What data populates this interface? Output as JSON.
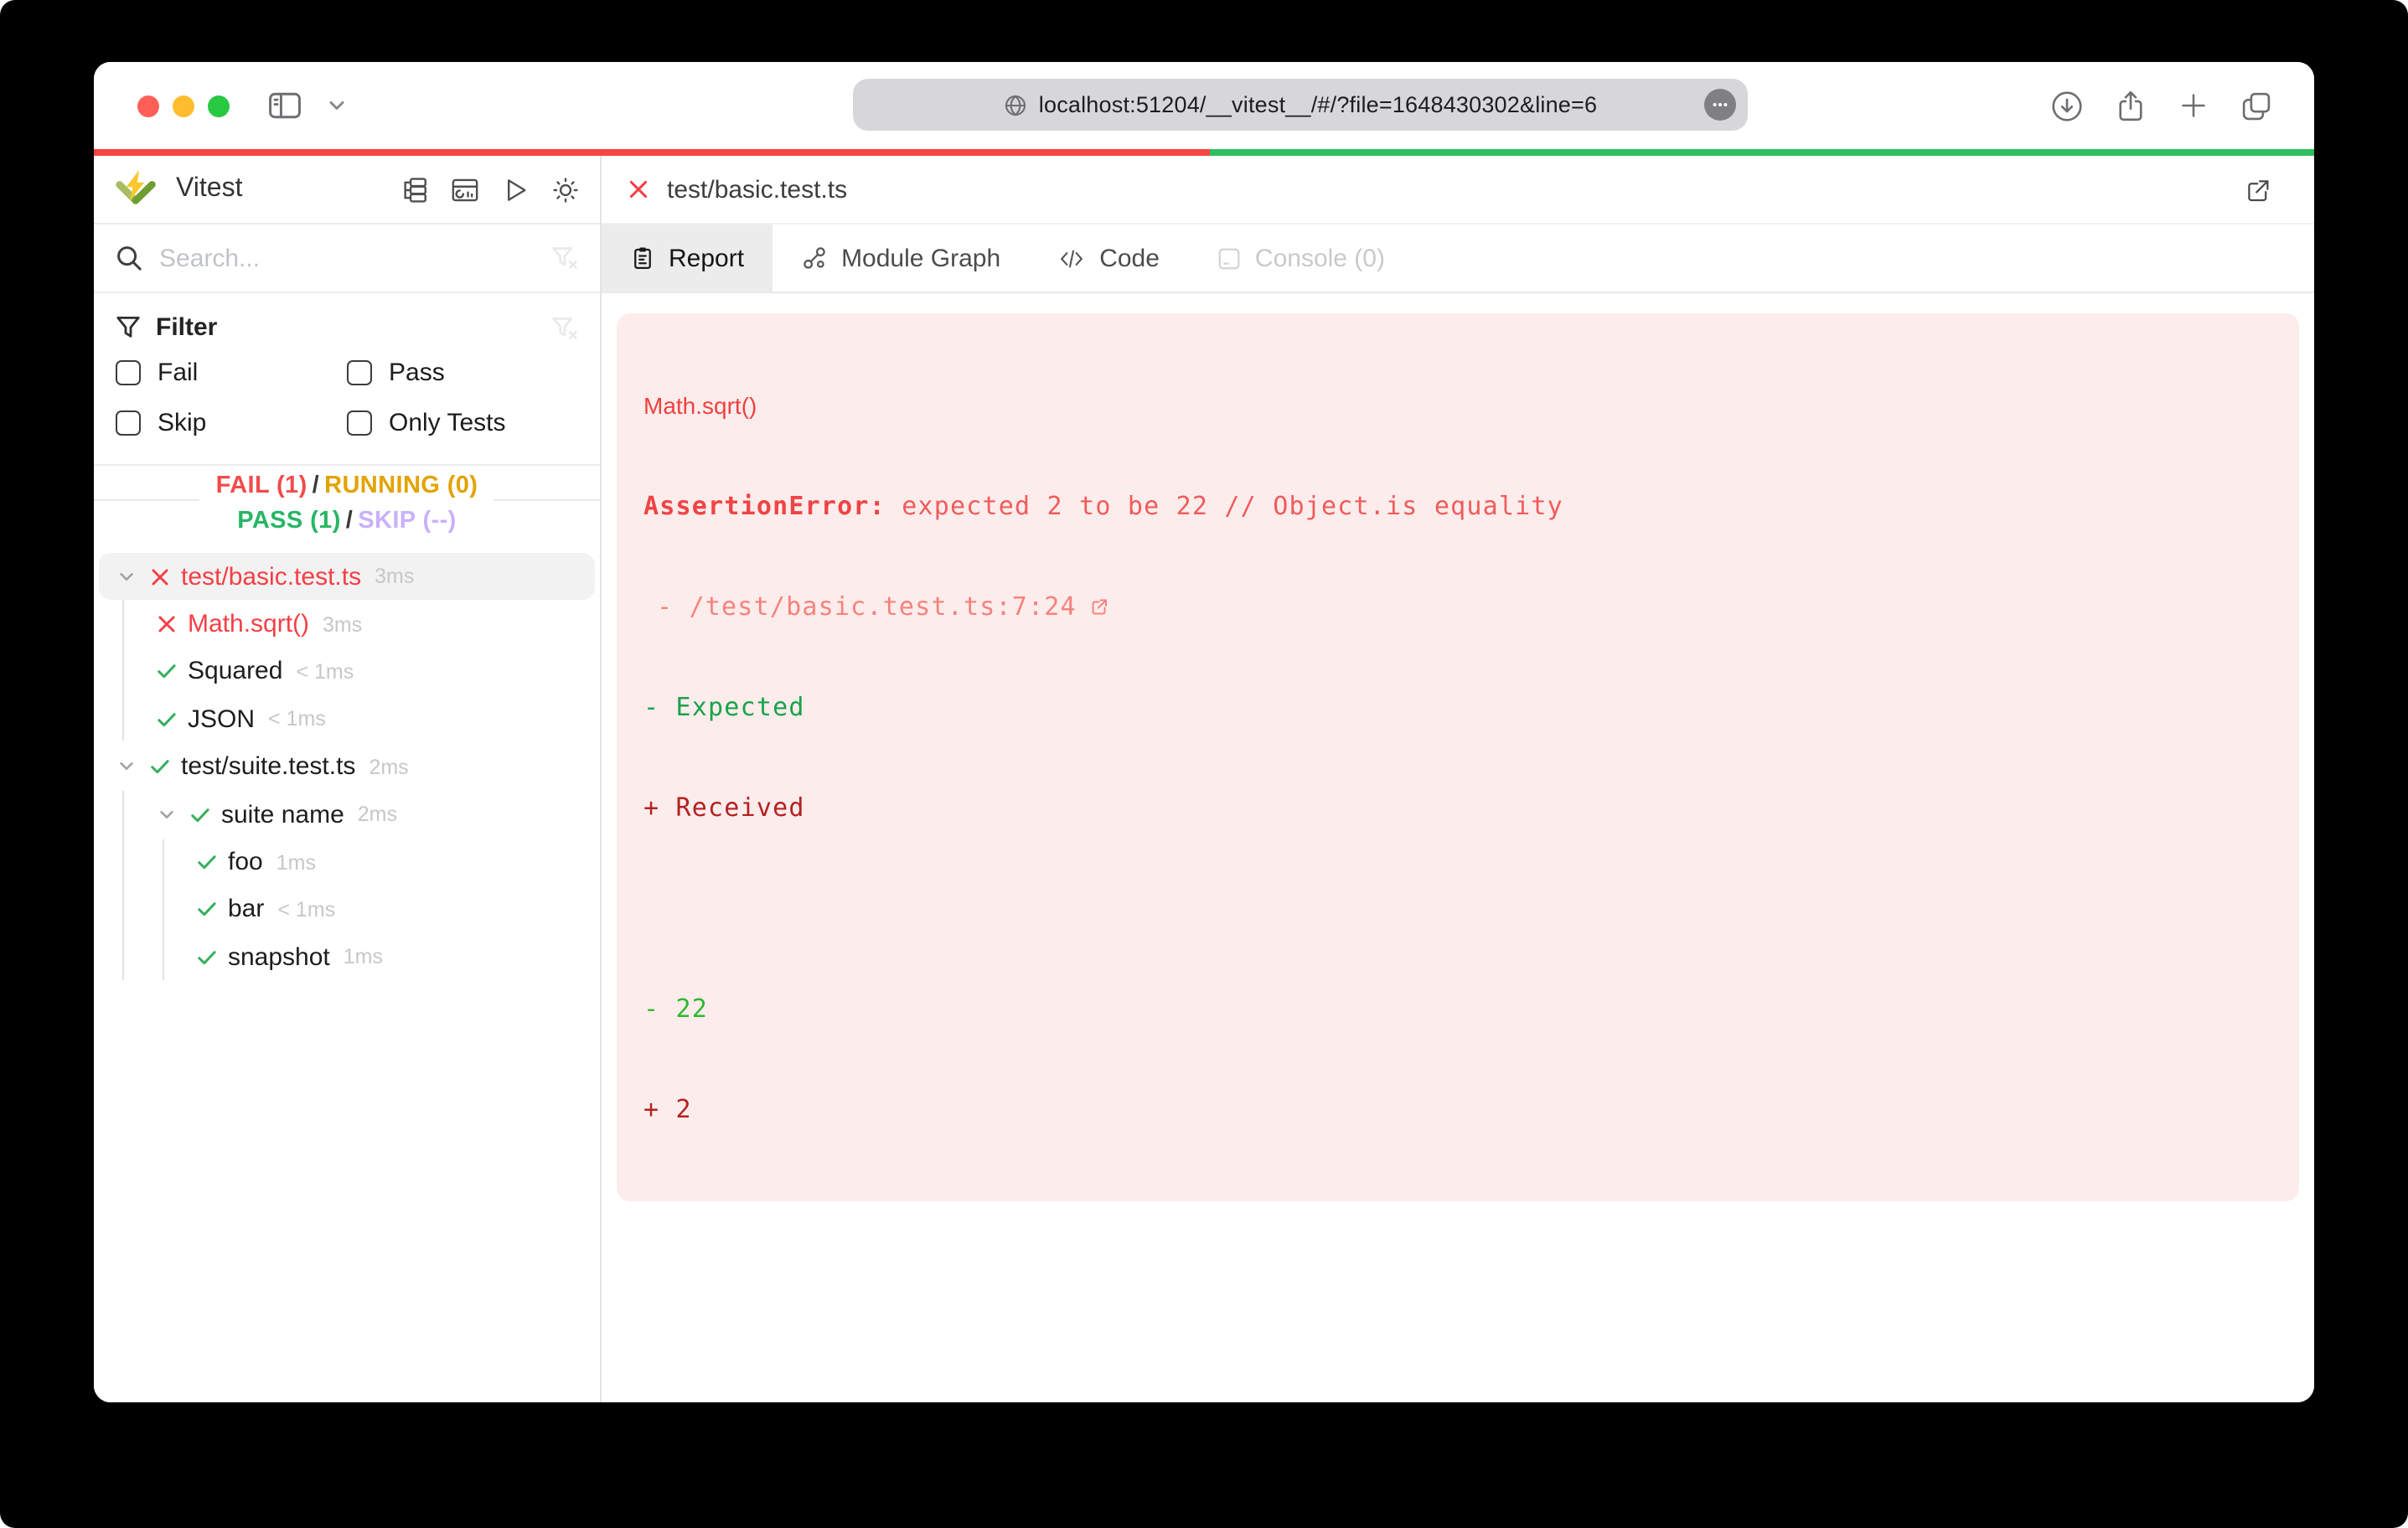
{
  "browser": {
    "url": "localhost:51204/__vitest__/#/?file=1648430302&line=6"
  },
  "sidebar": {
    "app_title": "Vitest",
    "search_placeholder": "Search...",
    "filter": {
      "title": "Filter",
      "options": [
        {
          "label": "Fail",
          "checked": false
        },
        {
          "label": "Pass",
          "checked": false
        },
        {
          "label": "Skip",
          "checked": false
        },
        {
          "label": "Only Tests",
          "checked": false
        }
      ]
    },
    "summary": {
      "fail": "FAIL (1)",
      "running": "RUNNING (0)",
      "pass": "PASS (1)",
      "skip": "SKIP (--)",
      "separator": "/"
    },
    "tree": {
      "items": [
        {
          "depth": 0,
          "expandable": true,
          "status": "fail",
          "label": "test/basic.test.ts",
          "duration": "3ms",
          "selected": true
        },
        {
          "depth": 1,
          "expandable": false,
          "status": "fail",
          "label": "Math.sqrt()",
          "duration": "3ms"
        },
        {
          "depth": 1,
          "expandable": false,
          "status": "pass",
          "label": "Squared",
          "duration": "< 1ms"
        },
        {
          "depth": 1,
          "expandable": false,
          "status": "pass",
          "label": "JSON",
          "duration": "< 1ms"
        },
        {
          "depth": 0,
          "expandable": true,
          "status": "pass",
          "label": "test/suite.test.ts",
          "duration": "2ms"
        },
        {
          "depth": 1,
          "expandable": true,
          "status": "pass",
          "label": "suite name",
          "duration": "2ms"
        },
        {
          "depth": 2,
          "expandable": false,
          "status": "pass",
          "label": "foo",
          "duration": "1ms"
        },
        {
          "depth": 2,
          "expandable": false,
          "status": "pass",
          "label": "bar",
          "duration": "< 1ms"
        },
        {
          "depth": 2,
          "expandable": false,
          "status": "pass",
          "label": "snapshot",
          "duration": "1ms"
        }
      ]
    }
  },
  "main": {
    "file_tab": {
      "label": "test/basic.test.ts"
    },
    "tabs": {
      "report": "Report",
      "module_graph": "Module Graph",
      "code": "Code",
      "console": "Console (0)"
    },
    "report": {
      "test_name": "Math.sqrt()",
      "error_name": "AssertionError: ",
      "error_message": "expected 2 to be 22 // Object.is equality",
      "stack_line": "- /test/basic.test.ts:7:24",
      "diff_expected_label": "- Expected",
      "diff_received_label": "+ Received",
      "diff_removed": "- 22",
      "diff_added": "+ 2"
    }
  },
  "colors": {
    "fail_red": "#f43f45",
    "pass_green": "#27b665",
    "running_amber": "#e2a300",
    "skip_purple": "#c9b1fa",
    "progress_red": "#fb4444",
    "progress_green": "#2fbe5f",
    "error_panel_bg": "#fdecec",
    "diff_removed_green": "#2eb82e",
    "diff_added_red": "#b42121",
    "brand_yellow": "#fcc72b",
    "brand_green": "#729b1b"
  }
}
